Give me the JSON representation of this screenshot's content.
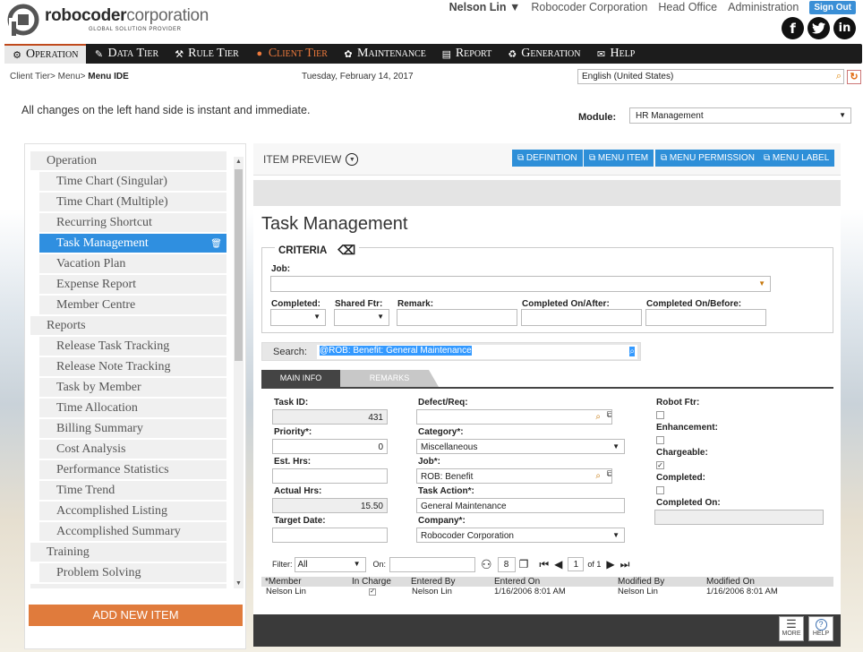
{
  "brand": {
    "name_bold": "robocoder",
    "name_light": "corporation",
    "tagline": "GLOBAL SOLUTION PROVIDER"
  },
  "topnav": {
    "user": "Nelson Lin",
    "company": "Robocoder Corporation",
    "office": "Head Office",
    "admin": "Administration",
    "signout": "Sign Out"
  },
  "social": [
    "facebook-icon",
    "twitter-icon",
    "linkedin-icon"
  ],
  "menu": [
    {
      "label": "Operation",
      "icon": "operation-icon"
    },
    {
      "label": "Data Tier",
      "icon": "data-tier-icon"
    },
    {
      "label": "Rule Tier",
      "icon": "rule-tier-icon"
    },
    {
      "label": "Client Tier",
      "icon": "globe-icon"
    },
    {
      "label": "Maintenance",
      "icon": "maintenance-icon"
    },
    {
      "label": "Report",
      "icon": "report-icon"
    },
    {
      "label": "Generation",
      "icon": "generation-icon"
    },
    {
      "label": "Help",
      "icon": "help-icon"
    }
  ],
  "breadcrumb": {
    "path": "Client Tier> Menu> ",
    "current": "Menu IDE"
  },
  "date": "Tuesday, February 14, 2017",
  "language": "English (United States)",
  "note": "All changes on the left hand side is instant and immediate.",
  "module": {
    "label": "Module:",
    "value": "HR Management"
  },
  "tree": [
    {
      "label": "Operation",
      "level": 0
    },
    {
      "label": "Time Chart (Singular)",
      "level": 1
    },
    {
      "label": "Time Chart (Multiple)",
      "level": 1
    },
    {
      "label": "Recurring Shortcut",
      "level": 1
    },
    {
      "label": "Task Management",
      "level": 1,
      "selected": true
    },
    {
      "label": "Vacation Plan",
      "level": 1
    },
    {
      "label": "Expense Report",
      "level": 1
    },
    {
      "label": "Member Centre",
      "level": 1
    },
    {
      "label": "Reports",
      "level": 0
    },
    {
      "label": "Release Task Tracking",
      "level": 1
    },
    {
      "label": "Release Note Tracking",
      "level": 1
    },
    {
      "label": "Task by Member",
      "level": 1
    },
    {
      "label": "Time Allocation",
      "level": 1
    },
    {
      "label": "Billing Summary",
      "level": 1
    },
    {
      "label": "Cost Analysis",
      "level": 1
    },
    {
      "label": "Performance Statistics",
      "level": 1
    },
    {
      "label": "Time Trend",
      "level": 1
    },
    {
      "label": "Accomplished Listing",
      "level": 1
    },
    {
      "label": "Accomplished Summary",
      "level": 1
    },
    {
      "label": "Training",
      "level": 0
    },
    {
      "label": "Problem Solving",
      "level": 1
    }
  ],
  "add_item": "ADD NEW ITEM",
  "preview": {
    "title": "ITEM PREVIEW",
    "buttons": [
      "DEFINITION",
      "MENU ITEM",
      "MENU PERMISSION",
      "MENU LABEL"
    ]
  },
  "form": {
    "title": "Task Management",
    "criteria": {
      "title": "CRITERIA",
      "job_label": "Job:",
      "completed_label": "Completed:",
      "shared_label": "Shared Ftr:",
      "remark_label": "Remark:",
      "after_label": "Completed On/After:",
      "before_label": "Completed On/Before:"
    },
    "search": {
      "label": "Search:",
      "value": "@ROB: Benefit: General Maintenance"
    },
    "tabs": [
      "MAIN INFO",
      "REMARKS"
    ],
    "fields": {
      "task_id_label": "Task ID:",
      "task_id": "431",
      "priority_label": "Priority*:",
      "priority": "0",
      "est_label": "Est. Hrs:",
      "est": "",
      "actual_label": "Actual Hrs:",
      "actual": "15.50",
      "target_label": "Target Date:",
      "target": "",
      "defect_label": "Defect/Req:",
      "defect": "",
      "category_label": "Category*:",
      "category": "Miscellaneous",
      "job_label": "Job*:",
      "job": "ROB: Benefit",
      "action_label": "Task Action*:",
      "action": "General Maintenance",
      "company_label": "Company*:",
      "company": "Robocoder Corporation",
      "robot_label": "Robot Ftr:",
      "enh_label": "Enhancement:",
      "charge_label": "Chargeable:",
      "completed_label": "Completed:",
      "completed_on_label": "Completed On:"
    },
    "checks": {
      "robot": false,
      "enhancement": false,
      "chargeable": true,
      "completed": false
    },
    "pager": {
      "filter_label": "Filter:",
      "filter": "All",
      "on_label": "On:",
      "count": "8",
      "page": "1",
      "of": "of 1"
    },
    "grid": {
      "headers": [
        "*Member",
        "In Charge",
        "Entered By",
        "Entered On",
        "Modified By",
        "Modified On"
      ],
      "row": [
        "Nelson Lin",
        "",
        "Nelson Lin",
        "1/16/2006 8:01 AM",
        "Nelson Lin",
        "1/16/2006 8:01 AM"
      ]
    },
    "footer": {
      "more": "MORE",
      "help": "HELP"
    }
  }
}
